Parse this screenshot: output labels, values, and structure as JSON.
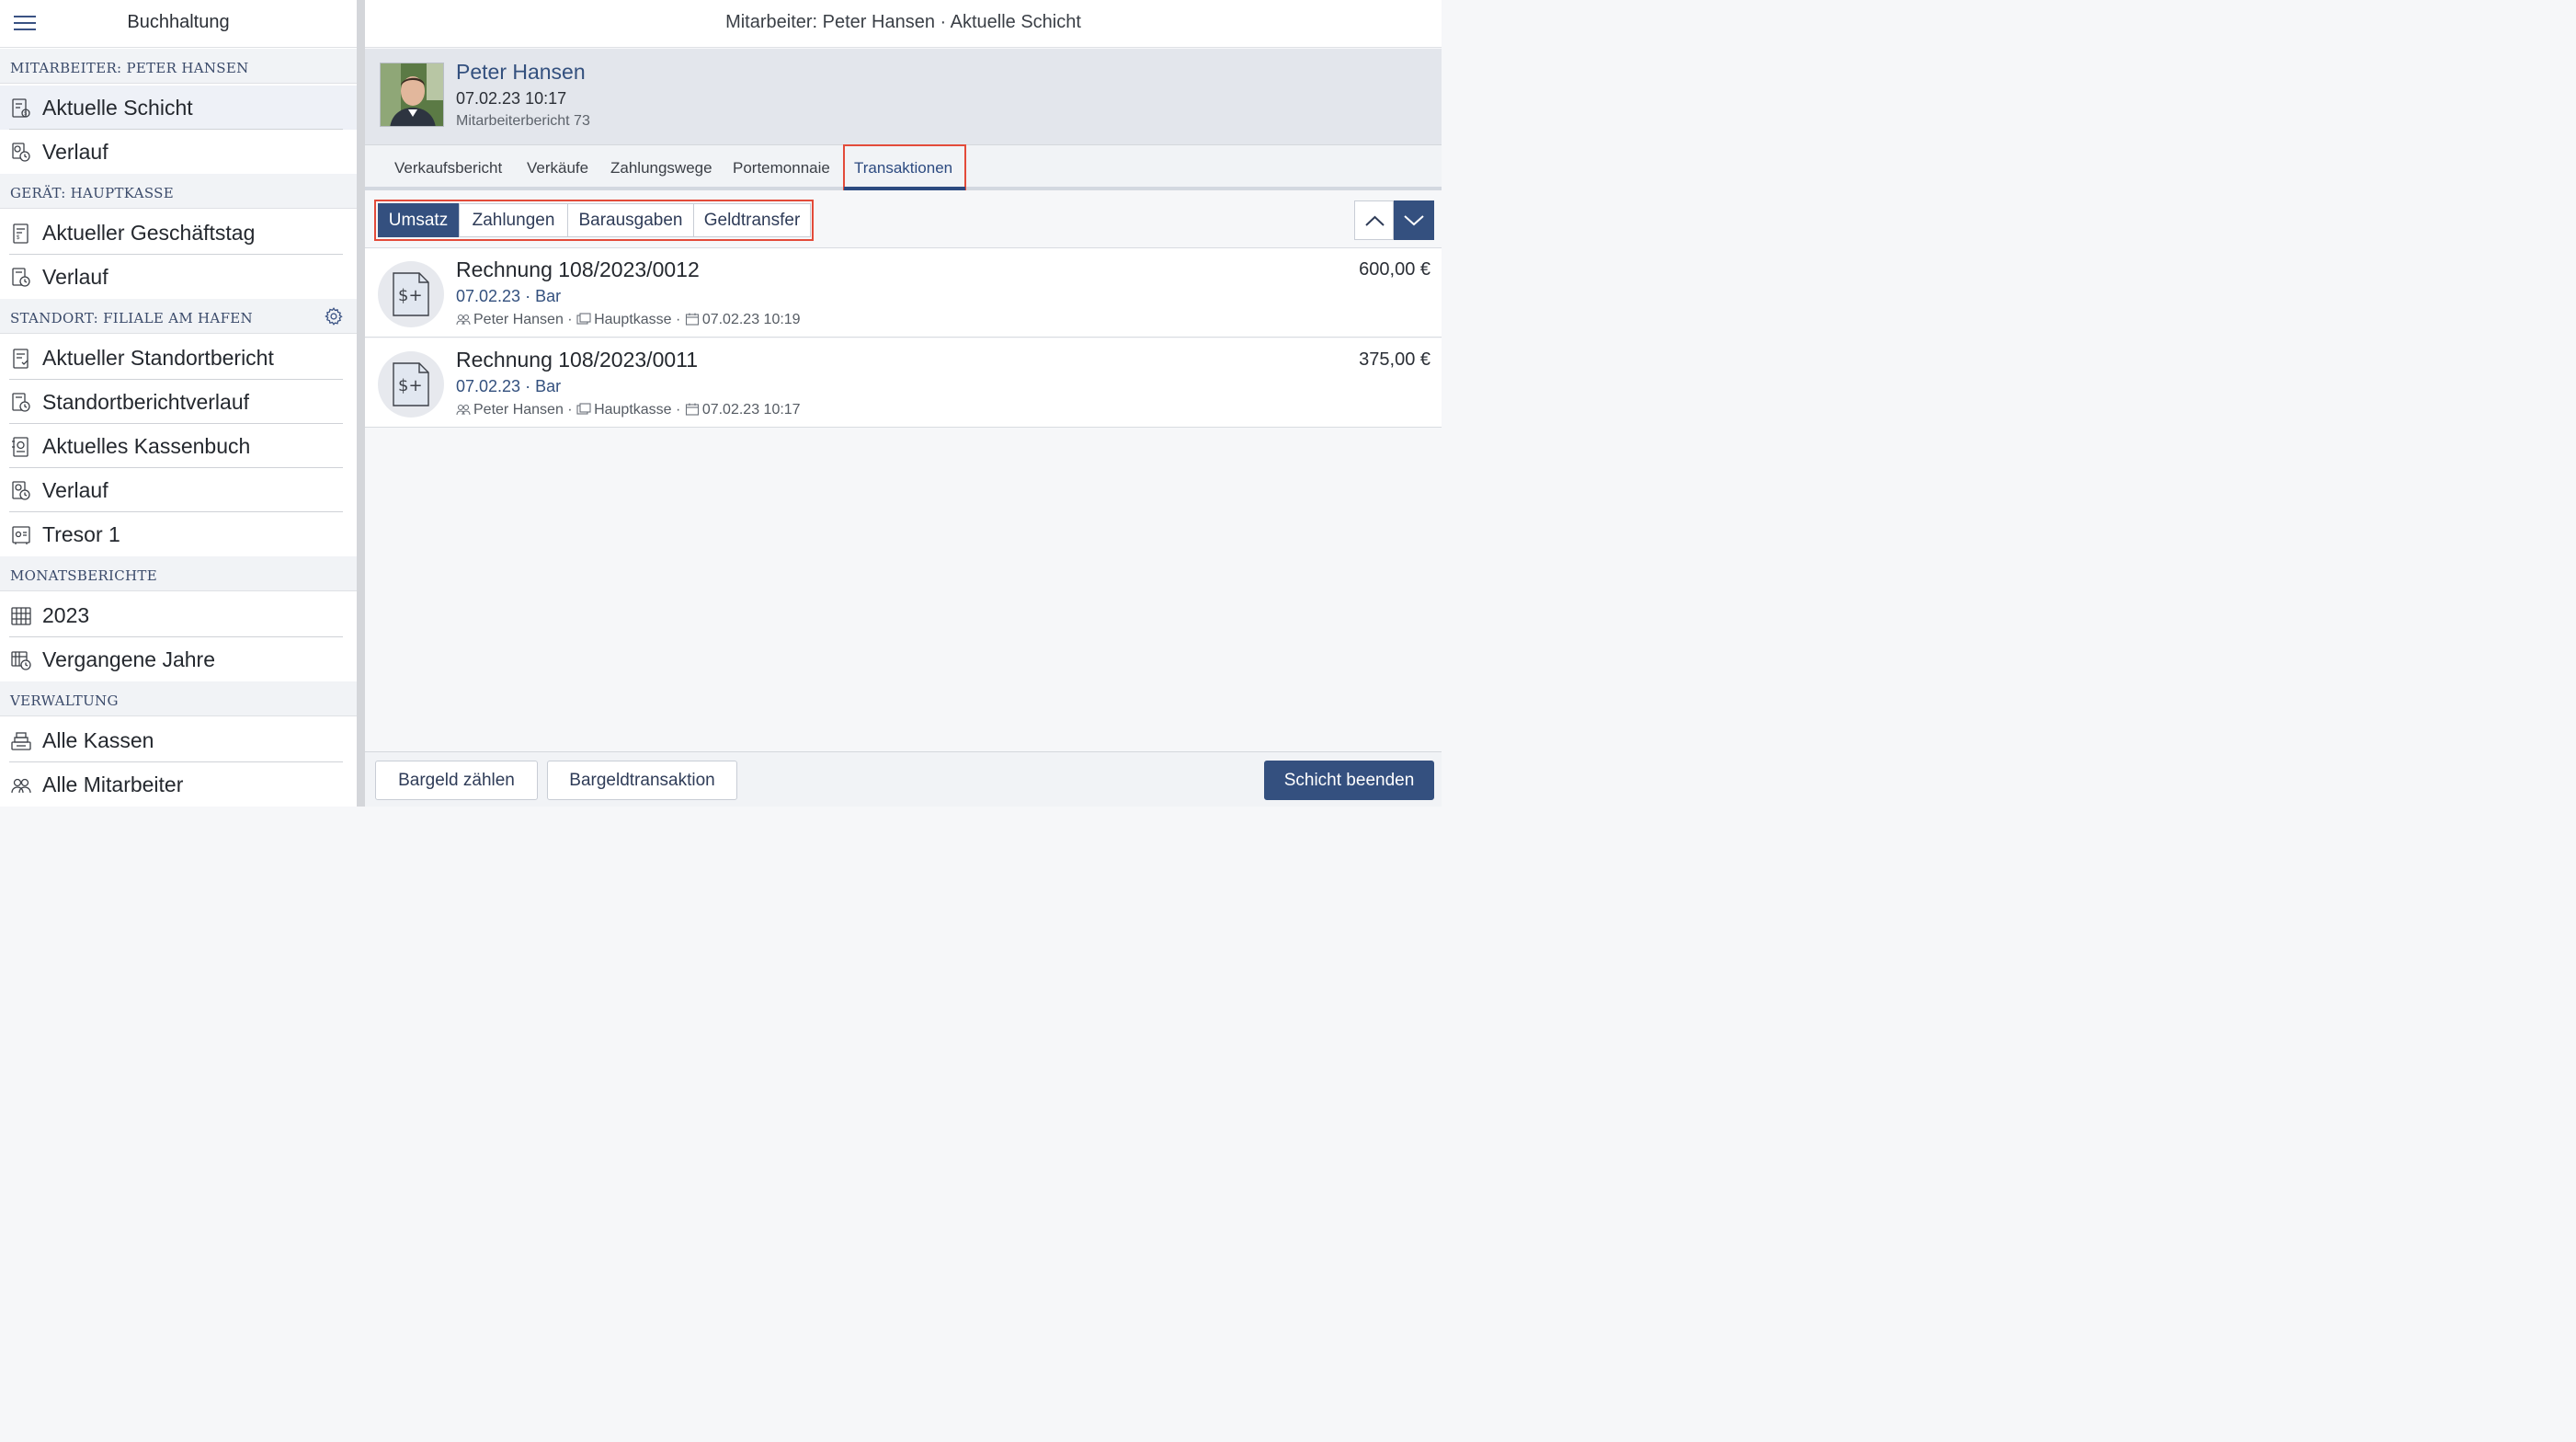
{
  "sidebar": {
    "title": "Buchhaltung",
    "sections": [
      {
        "header": "Mitarbeiter: Peter Hansen",
        "items": [
          "Aktuelle Schicht",
          "Verlauf"
        ]
      },
      {
        "header": "Gerät: Hauptkasse",
        "items": [
          "Aktueller Geschäftstag",
          "Verlauf"
        ]
      },
      {
        "header": "Standort: Filiale am Hafen",
        "items": [
          "Aktueller Standortbericht",
          "Standortberichtverlauf",
          "Aktuelles Kassenbuch",
          "Verlauf",
          "Tresor 1"
        ]
      },
      {
        "header": "Monatsberichte",
        "items": [
          "2023",
          "Vergangene Jahre"
        ]
      },
      {
        "header": "Verwaltung",
        "items": [
          "Alle Kassen",
          "Alle Mitarbeiter"
        ]
      }
    ]
  },
  "header": {
    "title": "Mitarbeiter: Peter Hansen · Aktuelle Schicht"
  },
  "profile": {
    "name": "Peter Hansen",
    "datetime": "07.02.23 10:17",
    "report": "Mitarbeiterbericht 73"
  },
  "tabs": [
    "Verkaufsbericht",
    "Verkäufe",
    "Zahlungswege",
    "Portemonnaie",
    "Transaktionen"
  ],
  "active_tab": "Transaktionen",
  "filters": [
    "Umsatz",
    "Zahlungen",
    "Barausgaben",
    "Geldtransfer"
  ],
  "active_filter": "Umsatz",
  "transactions": [
    {
      "title": "Rechnung 108/2023/0012",
      "subtitle": "07.02.23 · Bar",
      "employee": "Peter Hansen",
      "register": "Hauptkasse",
      "timestamp": "07.02.23 10:19",
      "amount": "600,00 €"
    },
    {
      "title": "Rechnung 108/2023/0011",
      "subtitle": "07.02.23 · Bar",
      "employee": "Peter Hansen",
      "register": "Hauptkasse",
      "timestamp": "07.02.23 10:17",
      "amount": "375,00 €"
    }
  ],
  "meta_separator": "·",
  "footer": {
    "count_cash": "Bargeld zählen",
    "cash_transaction": "Bargeldtransaktion",
    "end_shift": "Schicht beenden"
  },
  "colors": {
    "accent": "#34507f",
    "highlight": "#e34b3a",
    "active_item": "#eef1f7"
  },
  "icons": {
    "menu": "hamburger-menu-icon",
    "settings": "gear-icon",
    "document": "invoice-document-icon",
    "up": "chevron-up-icon",
    "down": "chevron-down-icon"
  }
}
